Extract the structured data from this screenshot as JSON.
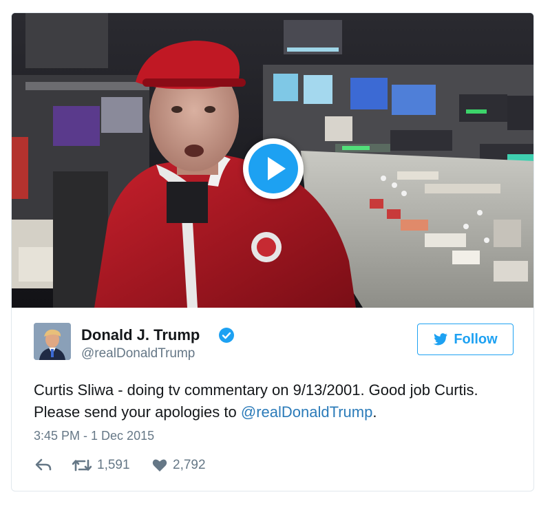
{
  "tweet": {
    "author_name": "Donald J. Trump",
    "author_handle": "@realDonaldTrump",
    "text_before_mention": "Curtis Sliwa - doing tv commentary on 9/13/2001. Good job Curtis. Please send your apologies to ",
    "mention": "@realDonaldTrump",
    "text_after_mention": ".",
    "timestamp": "3:45 PM - 1 Dec 2015",
    "retweets": "1,591",
    "likes": "2,792"
  },
  "follow_button": {
    "label": "Follow"
  },
  "icons": {
    "play": "play-icon",
    "verified": "verified-badge-icon",
    "follow": "twitter-bird-icon",
    "reply": "reply-icon",
    "retweet": "retweet-icon",
    "like": "heart-icon"
  },
  "colors": {
    "accent": "#1da1f2",
    "mention": "#2b7bb9",
    "secondary_text": "#657786",
    "border": "#e1e8ed"
  }
}
